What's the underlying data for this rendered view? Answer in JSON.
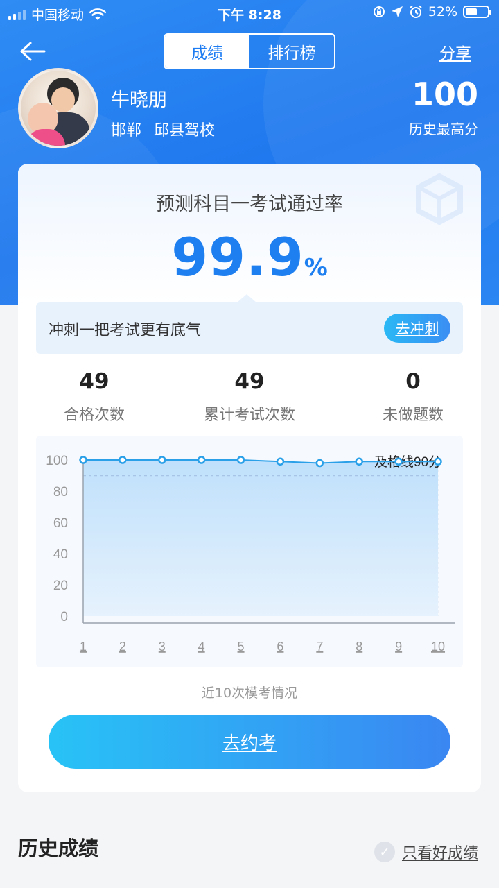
{
  "status_bar": {
    "carrier": "中国移动",
    "time": "下午 8:28",
    "battery": "52%"
  },
  "header": {
    "tabs": [
      {
        "label": "成绩",
        "active": true
      },
      {
        "label": "排行榜",
        "active": false
      }
    ],
    "share_label": "分享"
  },
  "profile": {
    "name": "牛晓朋",
    "city": "邯郸",
    "school": "邱县驾校",
    "best_score": "100",
    "best_score_label": "历史最高分"
  },
  "prediction": {
    "title": "预测科目一考试通过率",
    "rate": "99.9",
    "unit": "%"
  },
  "sprint": {
    "text": "冲刺一把考试更有底气",
    "button": "去冲刺"
  },
  "stats": [
    {
      "value": "49",
      "label": "合格次数"
    },
    {
      "value": "49",
      "label": "累计考试次数"
    },
    {
      "value": "0",
      "label": "未做题数"
    }
  ],
  "chart_data": {
    "type": "area",
    "categories": [
      "1",
      "2",
      "3",
      "4",
      "5",
      "6",
      "7",
      "8",
      "9",
      "10"
    ],
    "values": [
      100,
      100,
      100,
      100,
      100,
      99,
      98,
      99,
      99,
      99
    ],
    "ylim": [
      0,
      100
    ],
    "yticks": [
      "0",
      "20",
      "40",
      "60",
      "80",
      "100"
    ],
    "threshold": 90,
    "threshold_label": "及格线90分",
    "caption": "近10次模考情况",
    "color": "#2aa0e8"
  },
  "book_button": "去约考",
  "history": {
    "title": "历史成绩",
    "filter_label": "只看好成绩"
  },
  "colors": {
    "brand": "#1e7ff0",
    "accent_gradient_start": "#28c3f6",
    "accent_gradient_end": "#3a86f2"
  }
}
